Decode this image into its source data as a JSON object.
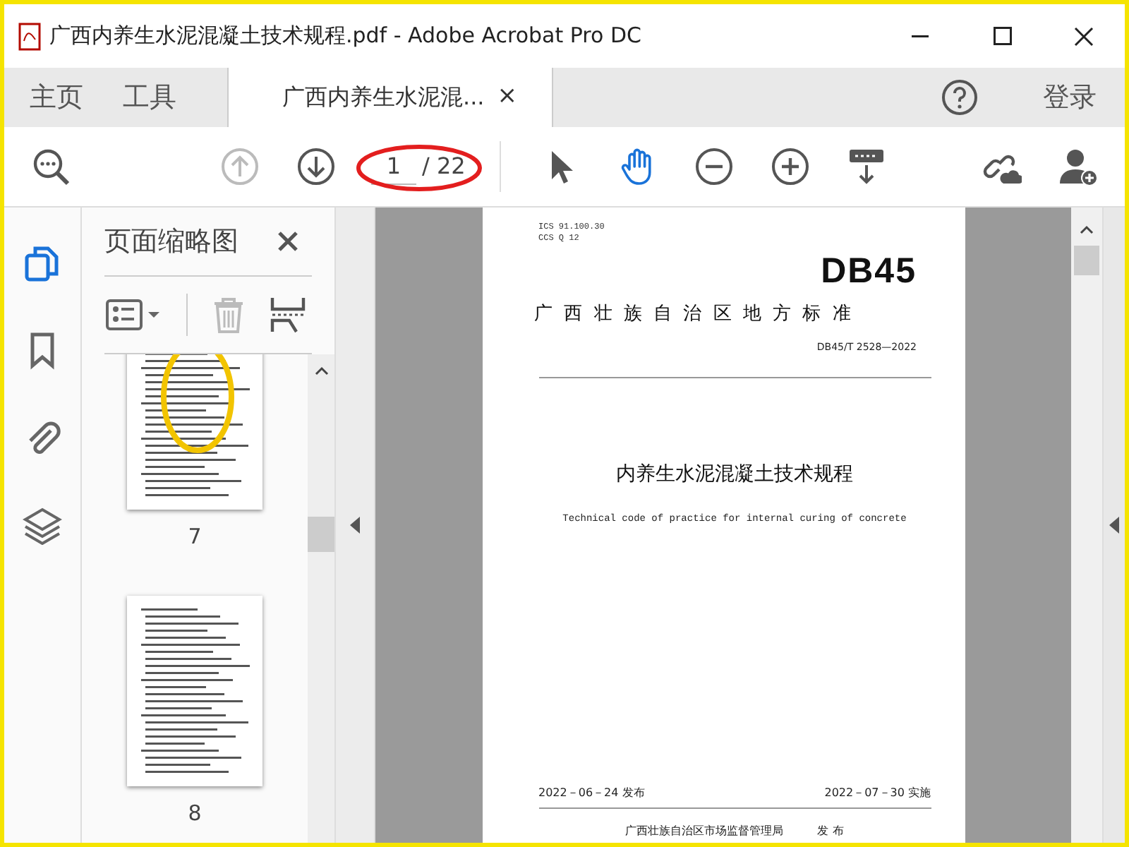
{
  "window": {
    "title": "广西内养生水泥混凝土技术规程.pdf - Adobe Acrobat Pro DC"
  },
  "tabs": [
    {
      "label": "主页",
      "selected": false
    },
    {
      "label": "工具",
      "selected": false
    },
    {
      "label": "广西内养生水泥混...",
      "selected": true,
      "close": "×"
    }
  ],
  "login": "登录",
  "toolbar": {
    "page_current": "1",
    "page_total": "/ 22"
  },
  "left_rail": [
    {
      "kind": "pages",
      "selected": true
    },
    {
      "kind": "bookmark",
      "selected": false
    },
    {
      "kind": "attachment",
      "selected": false
    },
    {
      "kind": "layers",
      "selected": false
    }
  ],
  "thumbnail_panel": {
    "title": "页面缩略图",
    "thumbnails": [
      {
        "page": "7",
        "kind": "stamped"
      },
      {
        "page": "8",
        "kind": "plain"
      }
    ]
  },
  "document": {
    "ics": "ICS 91.100.30",
    "ccs": "CCS Q 12",
    "logo": "DB45",
    "standard_type": "广 西 壮 族 自 治 区 地 方 标 准",
    "code": "DB45/T 2528—2022",
    "title": "内养生水泥混凝土技术规程",
    "subtitle": "Technical code of practice for internal curing of concrete",
    "issue_date": "2022－06－24 发布",
    "effective_date": "2022－07－30 实施",
    "issuer": "广西壮族自治区市场监督管理局",
    "issuer_action": "发 布"
  }
}
